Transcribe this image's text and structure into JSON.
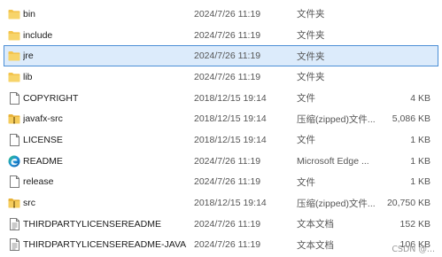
{
  "files": [
    {
      "name": "bin",
      "date": "2024/7/26 11:19",
      "type": "文件夹",
      "size": "",
      "icon": "folder-icon"
    },
    {
      "name": "include",
      "date": "2024/7/26 11:19",
      "type": "文件夹",
      "size": "",
      "icon": "folder-icon"
    },
    {
      "name": "jre",
      "date": "2024/7/26 11:19",
      "type": "文件夹",
      "size": "",
      "icon": "folder-icon",
      "selected": true
    },
    {
      "name": "lib",
      "date": "2024/7/26 11:19",
      "type": "文件夹",
      "size": "",
      "icon": "folder-icon"
    },
    {
      "name": "COPYRIGHT",
      "date": "2018/12/15 19:14",
      "type": "文件",
      "size": "4 KB",
      "icon": "file-icon"
    },
    {
      "name": "javafx-src",
      "date": "2018/12/15 19:14",
      "type": "压缩(zipped)文件...",
      "size": "5,086 KB",
      "icon": "zip-folder-icon"
    },
    {
      "name": "LICENSE",
      "date": "2018/12/15 19:14",
      "type": "文件",
      "size": "1 KB",
      "icon": "file-icon"
    },
    {
      "name": "README",
      "date": "2024/7/26 11:19",
      "type": "Microsoft Edge ...",
      "size": "1 KB",
      "icon": "edge-icon"
    },
    {
      "name": "release",
      "date": "2024/7/26 11:19",
      "type": "文件",
      "size": "1 KB",
      "icon": "file-icon"
    },
    {
      "name": "src",
      "date": "2018/12/15 19:14",
      "type": "压缩(zipped)文件...",
      "size": "20,750 KB",
      "icon": "zip-folder-icon"
    },
    {
      "name": "THIRDPARTYLICENSEREADME",
      "date": "2024/7/26 11:19",
      "type": "文本文档",
      "size": "152 KB",
      "icon": "text-file-icon"
    },
    {
      "name": "THIRDPARTYLICENSEREADME-JAVAFX",
      "date": "2024/7/26 11:19",
      "type": "文本文档",
      "size": "106 KB",
      "icon": "text-file-icon"
    }
  ],
  "watermark": "CSDN @...",
  "colors": {
    "selection_bg": "#dcebfb",
    "selection_border": "#4c8fd6",
    "folder": "#f3c44d"
  }
}
